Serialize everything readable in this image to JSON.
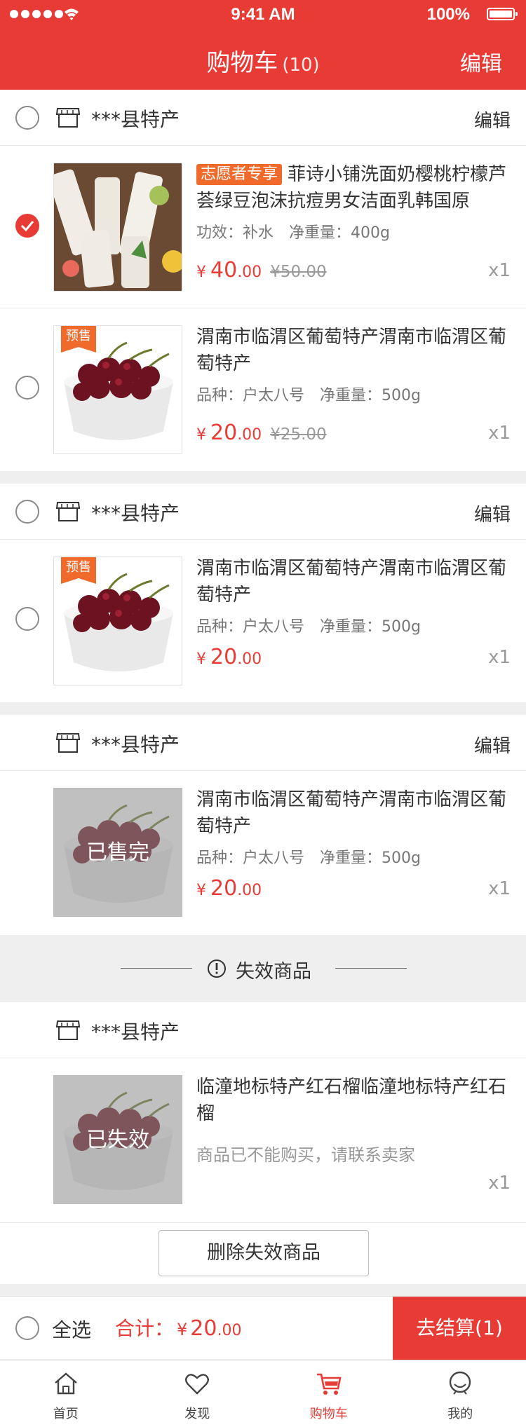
{
  "status_bar": {
    "time": "9:41 AM",
    "battery": "100%"
  },
  "nav": {
    "title": "购物车",
    "count": "(10)",
    "edit": "编辑"
  },
  "shops": [
    {
      "name": "***县特产",
      "edit": "编辑"
    },
    {
      "name": "***县特产",
      "edit": "编辑"
    },
    {
      "name": "***县特产",
      "edit": "编辑"
    },
    {
      "name": "***县特产"
    }
  ],
  "items": [
    {
      "tag": "志愿者专享",
      "title": "菲诗小铺洗面奶樱桃柠檬芦荟绿豆泡沫抗痘男女洁面乳韩国原",
      "spec_label1": "功效：补水",
      "spec_label2": "净重量：400g",
      "currency": "¥",
      "price_int": "40",
      "price_dec": ".00",
      "old_price": "¥50.00",
      "qty": "x1",
      "checked": true
    },
    {
      "badge": "预售",
      "title": "渭南市临渭区葡萄特产渭南市临渭区葡萄特产",
      "spec_label1": "品种：户太八号",
      "spec_label2": "净重量：500g",
      "currency": "¥",
      "price_int": "20",
      "price_dec": ".00",
      "old_price": "¥25.00",
      "qty": "x1",
      "checked": false
    },
    {
      "badge": "预售",
      "title": "渭南市临渭区葡萄特产渭南市临渭区葡萄特产",
      "spec_label1": "品种：户太八号",
      "spec_label2": "净重量：500g",
      "currency": "¥",
      "price_int": "20",
      "price_dec": ".00",
      "qty": "x1",
      "checked": false
    },
    {
      "overlay": "已售完",
      "title": "渭南市临渭区葡萄特产渭南市临渭区葡萄特产",
      "spec_label1": "品种：户太八号",
      "spec_label2": "净重量：500g",
      "currency": "¥",
      "price_int": "20",
      "price_dec": ".00",
      "qty": "x1"
    },
    {
      "overlay": "已失效",
      "title": "临潼地标特产红石榴临潼地标特产红石榴",
      "note": "商品已不能购买，请联系卖家",
      "qty": "x1"
    }
  ],
  "invalid_section": {
    "label": "失效商品"
  },
  "delete_invalid": "删除失效商品",
  "bottom": {
    "select_all": "全选",
    "total_label": "合计：",
    "currency": "¥",
    "total_int": "20",
    "total_dec": ".00",
    "checkout": "去结算(1)"
  },
  "tabs": [
    {
      "label": "首页",
      "icon": "home-icon"
    },
    {
      "label": "发现",
      "icon": "heart-icon"
    },
    {
      "label": "购物车",
      "icon": "cart-icon",
      "active": true
    },
    {
      "label": "我的",
      "icon": "user-icon"
    }
  ],
  "colors": {
    "primary": "#e93b35",
    "tag": "#f06a2c",
    "background": "#efefef"
  }
}
